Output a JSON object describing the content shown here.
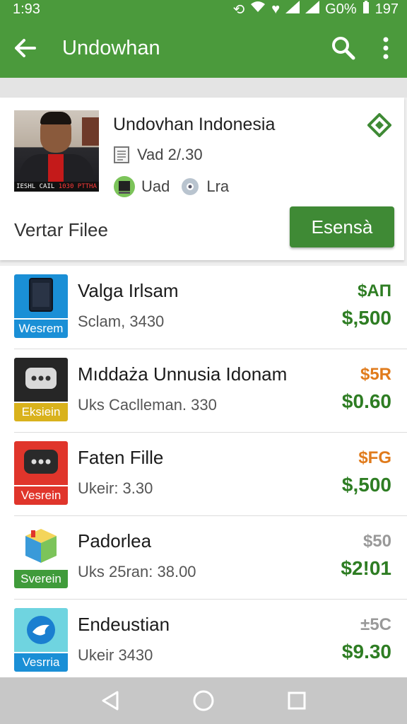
{
  "status_bar": {
    "time": "1:93",
    "battery": "G0%",
    "extra": "197"
  },
  "app_bar": {
    "title": "Undowhan",
    "back_icon": "arrow-left-icon",
    "search_icon": "search-icon",
    "more_icon": "more-vert-icon"
  },
  "header_card": {
    "name": "Undovhan Indonesia",
    "meta1": "Vad 2/.30",
    "meta2_a": "Uad",
    "meta2_b": "Lra",
    "photo_caption_a": "IESHL CAIL",
    "photo_caption_b": "1030 PTTHA",
    "bottom_label": "Vertar Filee",
    "button_label": "Esensà",
    "accent": "#3f8a35"
  },
  "items": [
    {
      "title": "Valga Irlsam",
      "sub": "Sclam, 3430",
      "tag": "Wesrem",
      "price_top": "$AП",
      "price_top_color": "#2e7d23",
      "price_bottom": "$,500",
      "icon_bg": "#1a8fd6",
      "tag_bg": "#1a8fd6"
    },
    {
      "title": "Mıddaża Unnusia Idonam",
      "sub": "Uks Caclleman. 330",
      "tag": "Eksiein",
      "price_top": "$5R",
      "price_top_color": "#e07b1c",
      "price_bottom": "$0.60",
      "icon_bg": "#262626",
      "tag_bg": "#d9b21c"
    },
    {
      "title": "Faten Fille",
      "sub": "Ukeir: 3.30",
      "tag": "Vesrein",
      "price_top": "$FG",
      "price_top_color": "#e07b1c",
      "price_bottom": "$,500",
      "icon_bg": "#e0352b",
      "tag_bg": "#e0352b"
    },
    {
      "title": "Padorlea",
      "sub": "Uks 25ran: 38.00",
      "tag": "Sverein",
      "price_top": "$50",
      "price_top_color": "#999999",
      "price_bottom": "$2!01",
      "icon_bg": "#ffffff",
      "tag_bg": "#3f9b3a"
    },
    {
      "title": "Endeustian",
      "sub": "Ukeir 3430",
      "tag": "Vesrria",
      "price_top": "±5C",
      "price_top_color": "#999999",
      "price_bottom": "$9.30",
      "icon_bg": "#6fd4e0",
      "tag_bg": "#1a8fd6"
    }
  ],
  "nav": {
    "back": "nav-back-icon",
    "home": "nav-home-icon",
    "recents": "nav-recents-icon"
  }
}
